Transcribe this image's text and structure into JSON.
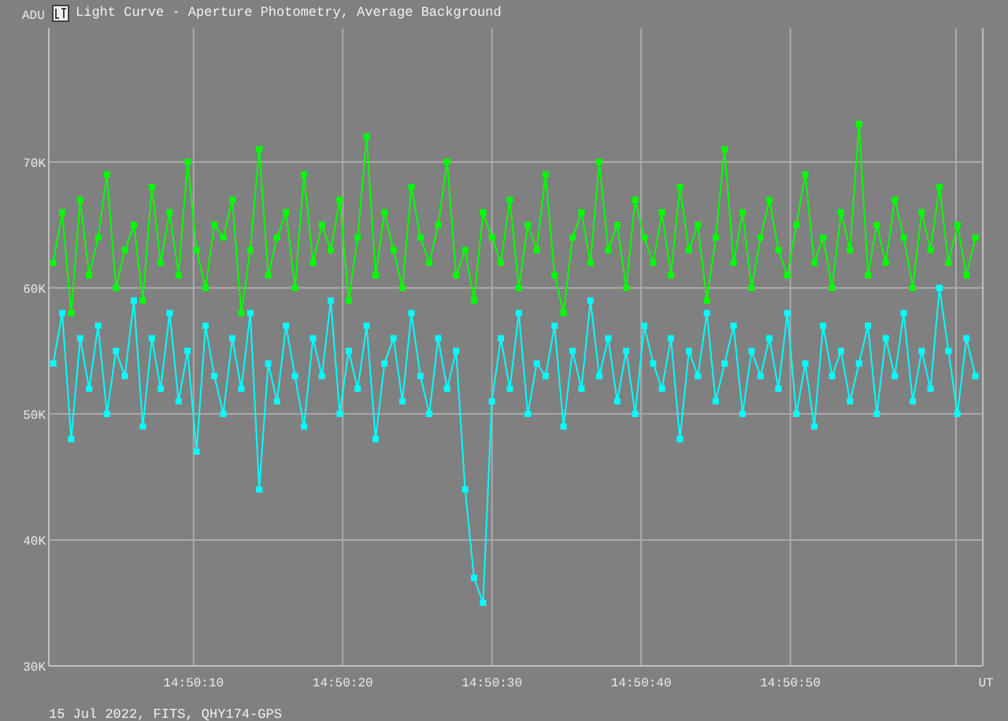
{
  "window": {
    "title": "Light Curve - Aperture Photometry, Average Background"
  },
  "chart": {
    "chart_data": {
      "type": "line",
      "xlabel": "UT",
      "ylabel": "ADU",
      "x": [
        53400.6,
        53401.2,
        53401.8,
        53402.4,
        53403,
        53403.6,
        53404.2,
        53404.8,
        53405.4,
        53406,
        53406.6,
        53407.2,
        53407.8,
        53408.4,
        53409,
        53409.6,
        53410.2,
        53410.8,
        53411.4,
        53412,
        53412.6,
        53413.2,
        53413.8,
        53414.4,
        53415,
        53415.6,
        53416.2,
        53416.8,
        53417.4,
        53418,
        53418.6,
        53419.2,
        53419.8,
        53420.4,
        53421,
        53421.6,
        53422.2,
        53422.8,
        53423.4,
        53424,
        53424.6,
        53425.2,
        53425.8,
        53426.4,
        53427,
        53427.6,
        53428.2,
        53428.8,
        53429.4,
        53430,
        53430.6,
        53431.2,
        53431.8,
        53432.4,
        53433,
        53433.6,
        53434.2,
        53434.8,
        53435.4,
        53436,
        53436.6,
        53437.2,
        53437.8,
        53438.4,
        53439,
        53439.6,
        53440.2,
        53440.8,
        53441.4,
        53442,
        53442.6,
        53443.2,
        53443.8,
        53444.4,
        53445,
        53445.6,
        53446.2,
        53446.8,
        53447.4,
        53448,
        53448.6,
        53449.2,
        53449.8,
        53450.4,
        53451,
        53451.6,
        53452.2,
        53452.8,
        53453.4,
        53454,
        53454.6,
        53455.2,
        53455.8,
        53456.4,
        53457,
        53457.6,
        53458.2,
        53458.8,
        53459.4,
        53460,
        53460.6,
        53461.2,
        53461.8,
        53462.4
      ],
      "series": [
        {
          "color": "#00ff00",
          "marker": "square",
          "values": [
            62,
            66,
            58,
            67,
            61,
            64,
            69,
            60,
            63,
            65,
            59,
            68,
            62,
            66,
            61,
            70,
            63,
            60,
            65,
            64,
            67,
            58,
            63,
            71,
            61,
            64,
            66,
            60,
            69,
            62,
            65,
            63,
            67,
            59,
            64,
            72,
            61,
            66,
            63,
            60,
            68,
            64,
            62,
            65,
            70,
            61,
            63,
            59,
            66,
            64,
            62,
            67,
            60,
            65,
            63,
            69,
            61,
            58,
            64,
            66,
            62,
            70,
            63,
            65,
            60,
            67,
            64,
            62,
            66,
            61,
            68,
            63,
            65,
            59,
            64,
            71,
            62,
            66,
            60,
            64,
            67,
            63,
            61,
            65,
            69,
            62,
            64,
            60,
            66,
            63,
            73,
            61,
            65,
            62,
            67,
            64,
            60,
            66,
            63,
            68,
            62,
            65,
            61,
            64
          ]
        },
        {
          "color": "#00ffff",
          "marker": "square",
          "values": [
            54,
            58,
            48,
            56,
            52,
            57,
            50,
            55,
            53,
            59,
            49,
            56,
            52,
            58,
            51,
            55,
            47,
            57,
            53,
            50,
            56,
            52,
            58,
            44,
            54,
            51,
            57,
            53,
            49,
            56,
            53,
            59,
            50,
            55,
            52,
            57,
            48,
            54,
            56,
            51,
            58,
            53,
            50,
            56,
            52,
            55,
            44,
            37,
            35,
            51,
            56,
            52,
            58,
            50,
            54,
            53,
            57,
            49,
            55,
            52,
            59,
            53,
            56,
            51,
            55,
            50,
            57,
            54,
            52,
            56,
            48,
            55,
            53,
            58,
            51,
            54,
            57,
            50,
            55,
            53,
            56,
            52,
            58,
            50,
            54,
            49,
            57,
            53,
            55,
            51,
            54,
            57,
            50,
            56,
            53,
            58,
            51,
            55,
            52,
            60,
            55,
            50,
            56,
            53
          ]
        }
      ],
      "grid": true,
      "xlim": [
        53400.3,
        53462.9
      ],
      "ylim": [
        30,
        80.6
      ],
      "xticks": [
        {
          "value": 53410,
          "label": "14:50:10"
        },
        {
          "value": 53420,
          "label": "14:50:20"
        },
        {
          "value": 53430,
          "label": "14:50:30"
        },
        {
          "value": 53440,
          "label": "14:50:40"
        },
        {
          "value": 53450,
          "label": "14:50:50"
        }
      ],
      "yticks": [
        {
          "value": 30,
          "label": "30K"
        },
        {
          "value": 40,
          "label": "40K"
        },
        {
          "value": 50,
          "label": "50K"
        },
        {
          "value": 60,
          "label": "60K"
        },
        {
          "value": 70,
          "label": "70K"
        }
      ]
    }
  },
  "footer": "15 Jul 2022, FITS, QHY174-GPS"
}
